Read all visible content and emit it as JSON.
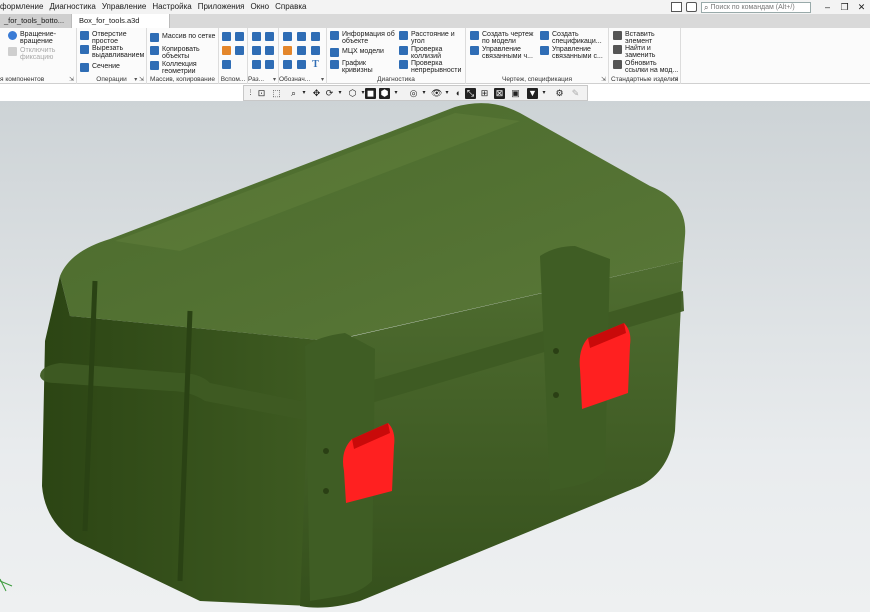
{
  "window": {
    "menu": [
      "формление",
      "Диагностика",
      "Управление",
      "Настройка",
      "Приложения",
      "Окно",
      "Справка"
    ],
    "search_placeholder": "Поиск по командам (Alt+/)"
  },
  "tabs": [
    {
      "label": "_for_tools_botto...",
      "active": false
    },
    {
      "label": "Box_for_tools.a3d",
      "active": true
    }
  ],
  "ribbon": {
    "groups": [
      {
        "label": "я компонентов",
        "items": [
          "Вращение-\nвращение",
          "Отключить\nфиксацию"
        ]
      },
      {
        "label": "Операции",
        "items": [
          "Отверстие\nпростое",
          "Вырезать\nвыдавливанием",
          "Сечение"
        ]
      },
      {
        "label": "Массив, копирование",
        "items": [
          "Массив по сетке",
          "Копировать\nобъекты",
          "Коллекция\nгеометрии"
        ]
      },
      {
        "label": "Вспом..."
      },
      {
        "label": "Раз..."
      },
      {
        "label": "Обознач..."
      },
      {
        "label": "Диагностика",
        "items": [
          "Информация об\nобъекте",
          "МЦХ модели",
          "График\nкривизны",
          "Расстояние и\nугол",
          "Проверка\nколлизий",
          "Проверка\nнепрерывности"
        ]
      },
      {
        "label": "Чертеж, спецификация",
        "items": [
          "Создать чертеж\nпо модели",
          "Управление\nсвязанными ч...",
          "Создать\nспецификаци...",
          "Управление\nсвязанными с..."
        ]
      },
      {
        "label": "Стандартные изделия",
        "items": [
          "Вставить\nэлемент",
          "Найти и\nзаменить",
          "Обновить\nссылки на мод..."
        ]
      }
    ]
  },
  "colors": {
    "accent": "#2f6db5",
    "model_body": "#4d6a2e",
    "latch": "#ff2020"
  }
}
